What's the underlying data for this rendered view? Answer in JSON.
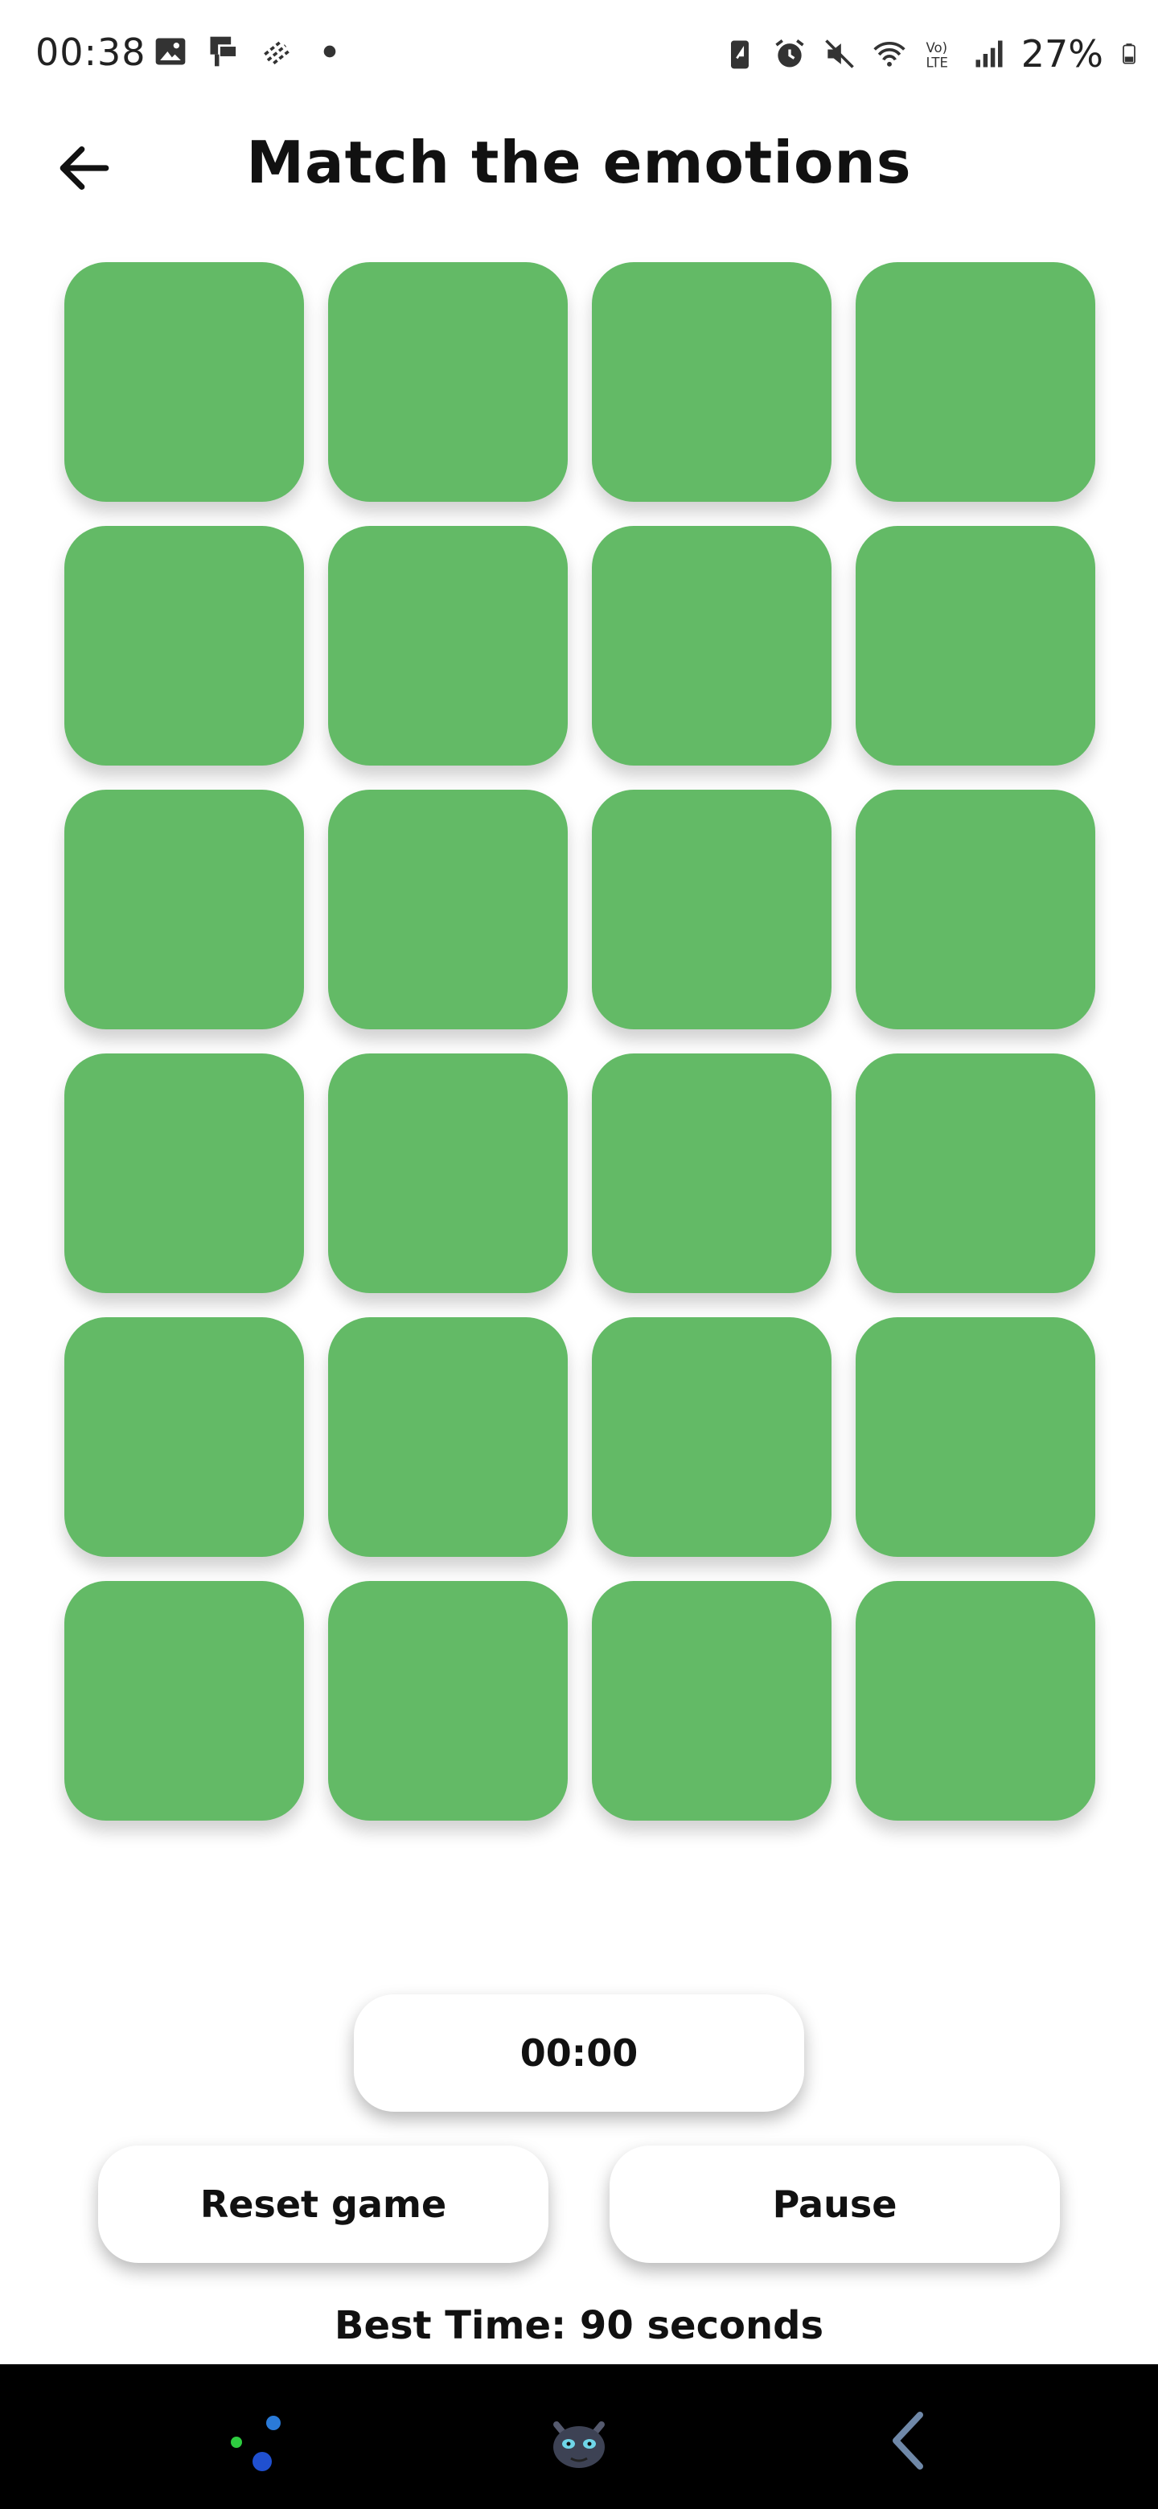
{
  "status_bar": {
    "time": "00:38",
    "battery": "27%",
    "left_icons": [
      "image-icon",
      "cast-icon",
      "data-saver-icon",
      "dot-icon"
    ],
    "right_icons": [
      "battery-saver-icon",
      "alarm-icon",
      "mute-icon",
      "wifi-icon",
      "volte-icon",
      "signal-icon",
      "battery-icon"
    ]
  },
  "header": {
    "title": "Match the emotions",
    "back_icon": "arrow-left-icon"
  },
  "game": {
    "columns": 4,
    "rows": 6,
    "card_color": "#63BA66",
    "face_down_cards": 24
  },
  "timer": {
    "value": "00:00"
  },
  "controls": {
    "reset_label": "Reset game",
    "pause_label": "Pause"
  },
  "best_time": "Best Time: 90 seconds",
  "nav_bar": {
    "background": "#000000",
    "items": [
      "assistant-dots-icon",
      "character-avatar-icon",
      "back-gesture-icon"
    ]
  }
}
